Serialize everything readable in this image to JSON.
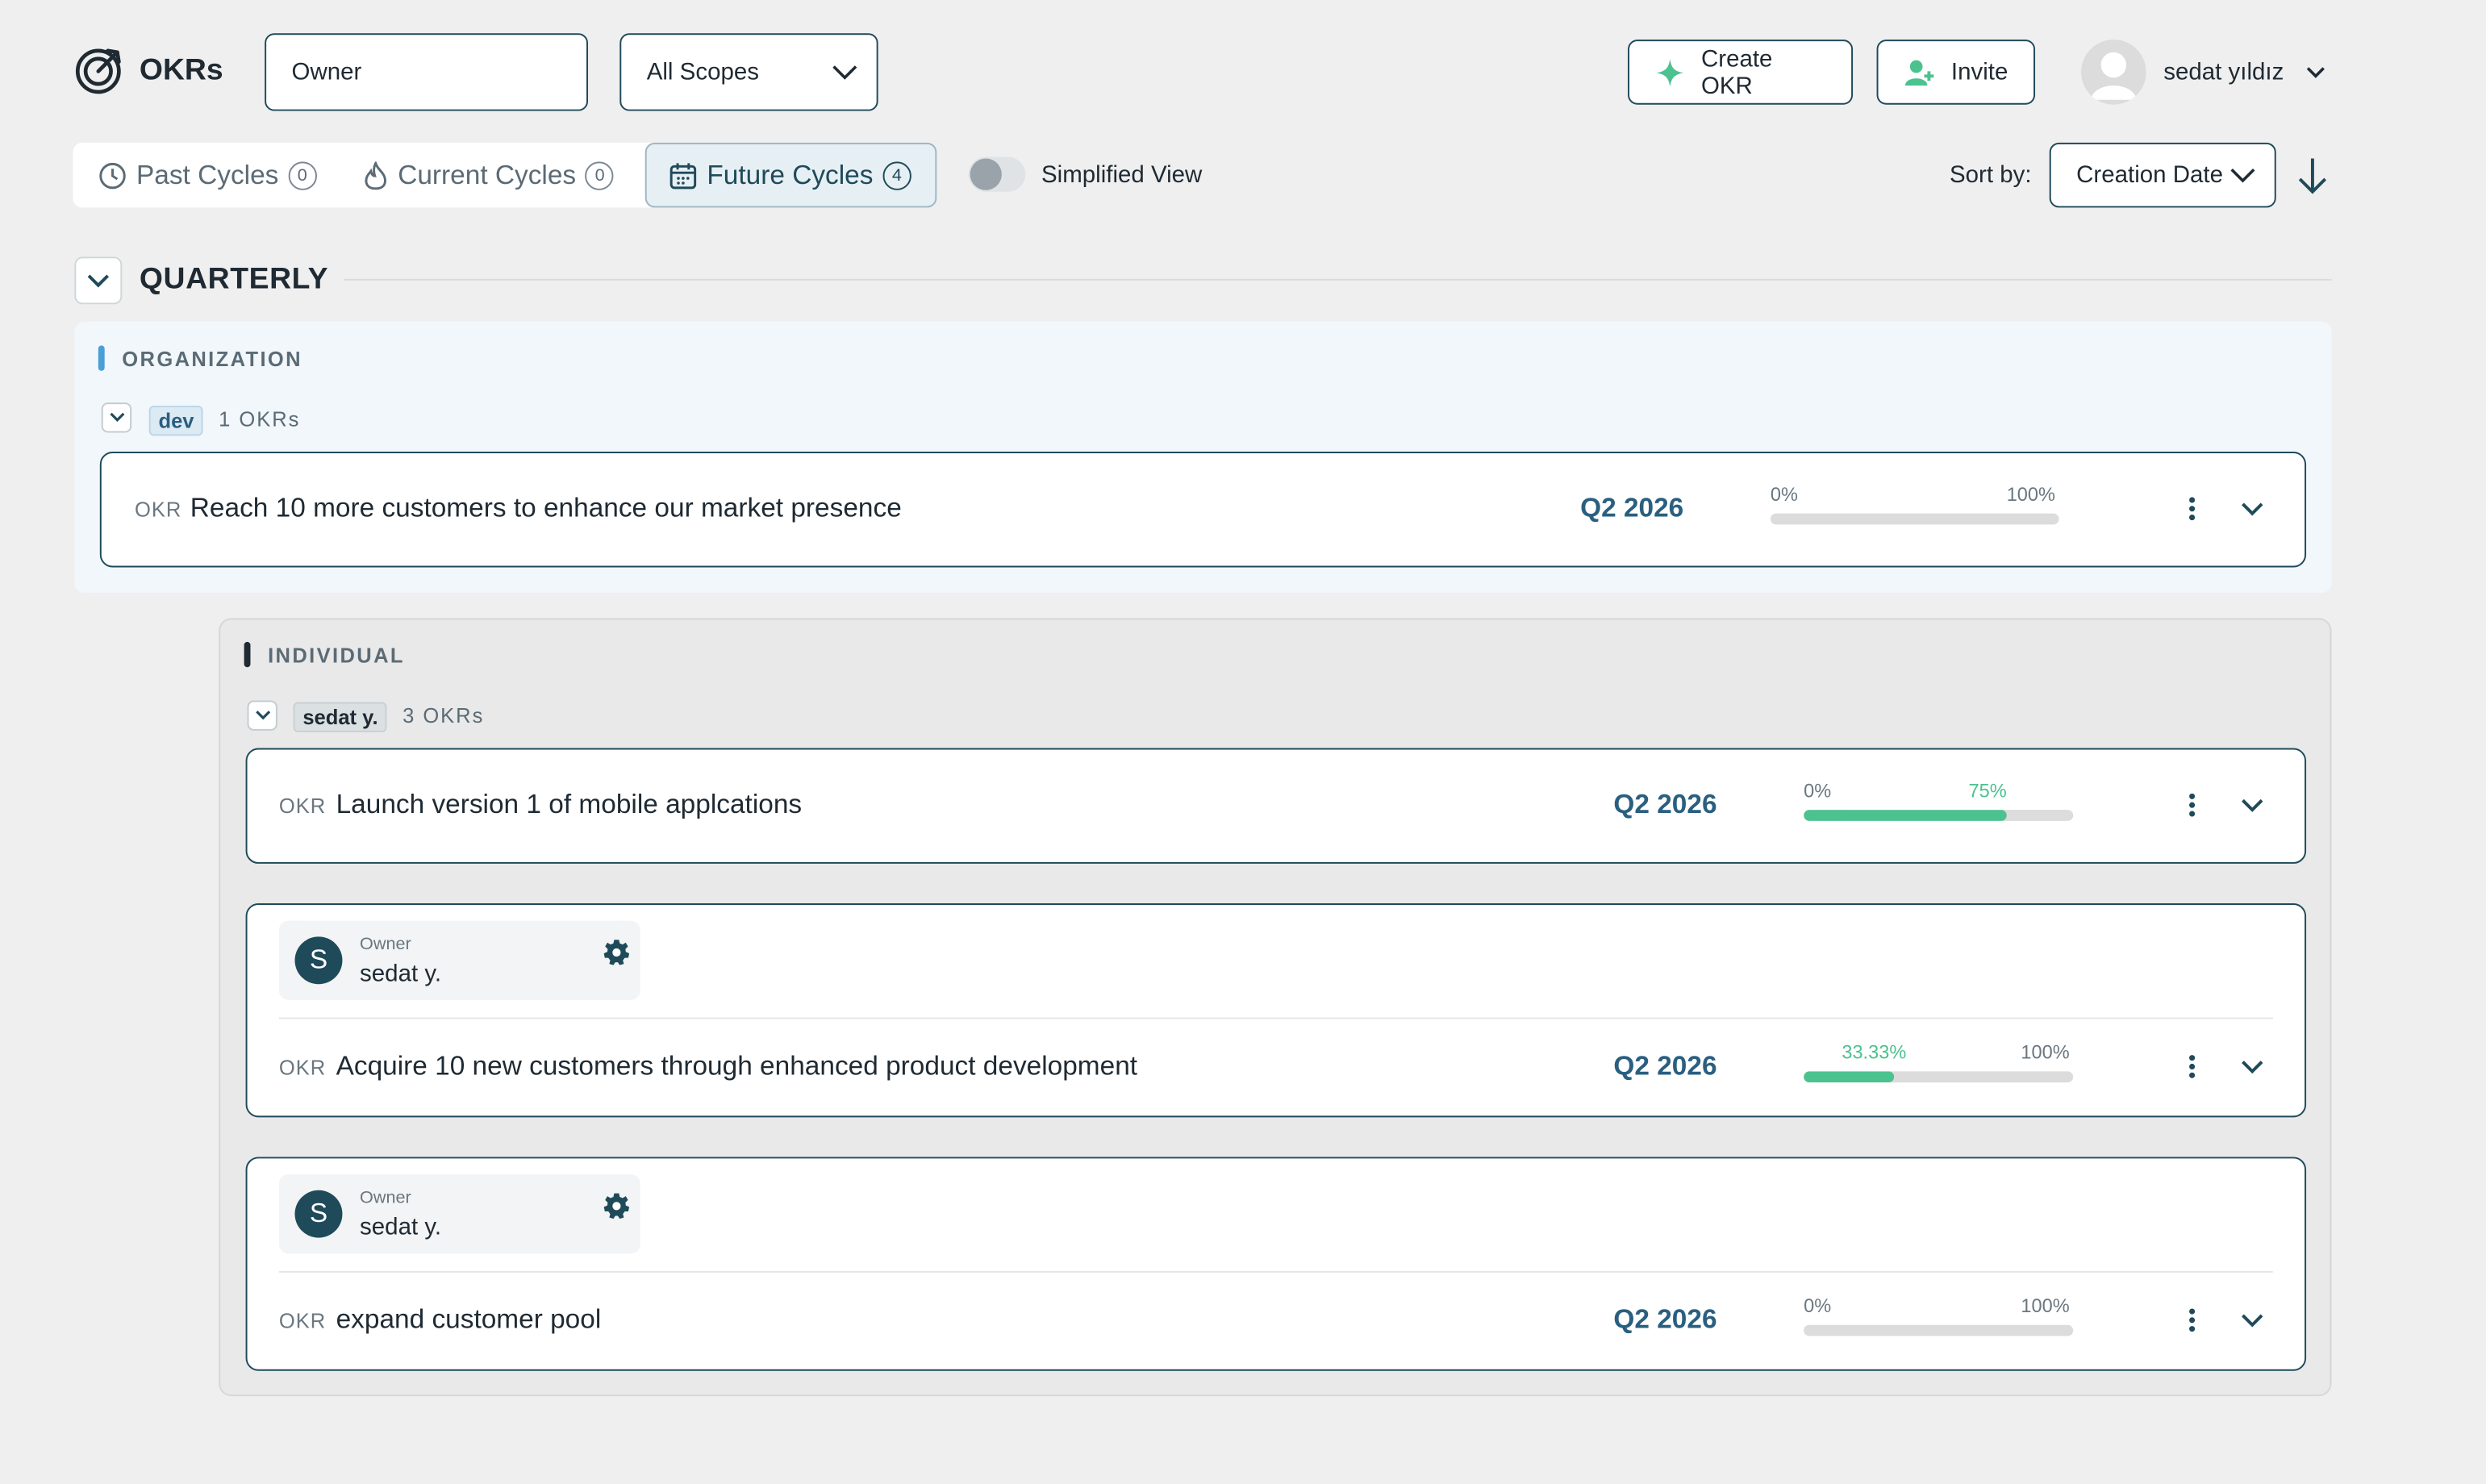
{
  "app": {
    "title": "OKRs"
  },
  "filters": {
    "owner_placeholder": "Owner",
    "scope_value": "All Scopes"
  },
  "actions": {
    "create_label": "Create OKR",
    "invite_label": "Invite"
  },
  "user": {
    "name": "sedat yıldız"
  },
  "tabs": [
    {
      "label": "Past Cycles",
      "count": "0",
      "icon": "clock-icon"
    },
    {
      "label": "Current Cycles",
      "count": "0",
      "icon": "flame-icon"
    },
    {
      "label": "Future Cycles",
      "count": "4",
      "icon": "calendar-icon",
      "active": true
    }
  ],
  "view": {
    "simplified_label": "Simplified View",
    "simplified_on": false
  },
  "sort": {
    "label": "Sort by:",
    "value": "Creation Date",
    "direction": "descending"
  },
  "section": {
    "title": "QUARTERLY"
  },
  "groups": [
    {
      "label": "ORGANIZATION",
      "color": "#4a9fd8",
      "subgroups": [
        {
          "tag": "dev",
          "count": "1 OKRs",
          "okrs": [
            {
              "tag": "OKR",
              "title": "Reach 10 more customers to enhance our market presence",
              "quarter": "Q2 2026",
              "progress": 0,
              "left_label": "0%",
              "right_label": "100%"
            }
          ]
        }
      ]
    },
    {
      "label": "INDIVIDUAL",
      "color": "#1f2a33",
      "subgroups": [
        {
          "tag": "sedat y.",
          "count": "3 OKRs",
          "okrs": [
            {
              "tag": "OKR",
              "title": "Launch version 1 of mobile applcations",
              "quarter": "Q2 2026",
              "progress": 75,
              "left_label": "0%",
              "right_label": "75%"
            },
            {
              "tag": "OKR",
              "title": "Acquire 10 new customers through enhanced product development",
              "quarter": "Q2 2026",
              "progress": 33.33,
              "left_label": "33.33%",
              "right_label": "100%",
              "owner": {
                "label": "Owner",
                "name": "sedat y.",
                "initial": "S"
              }
            },
            {
              "tag": "OKR",
              "title": "expand customer pool",
              "quarter": "Q2 2026",
              "progress": 0,
              "left_label": "0%",
              "right_label": "100%",
              "owner": {
                "label": "Owner",
                "name": "sedat y.",
                "initial": "S"
              }
            }
          ]
        }
      ]
    }
  ],
  "colors": {
    "accent": "#1f4a5a",
    "quarter": "#2a5f80",
    "progress": "#4cc28f",
    "background": "#efefef"
  }
}
